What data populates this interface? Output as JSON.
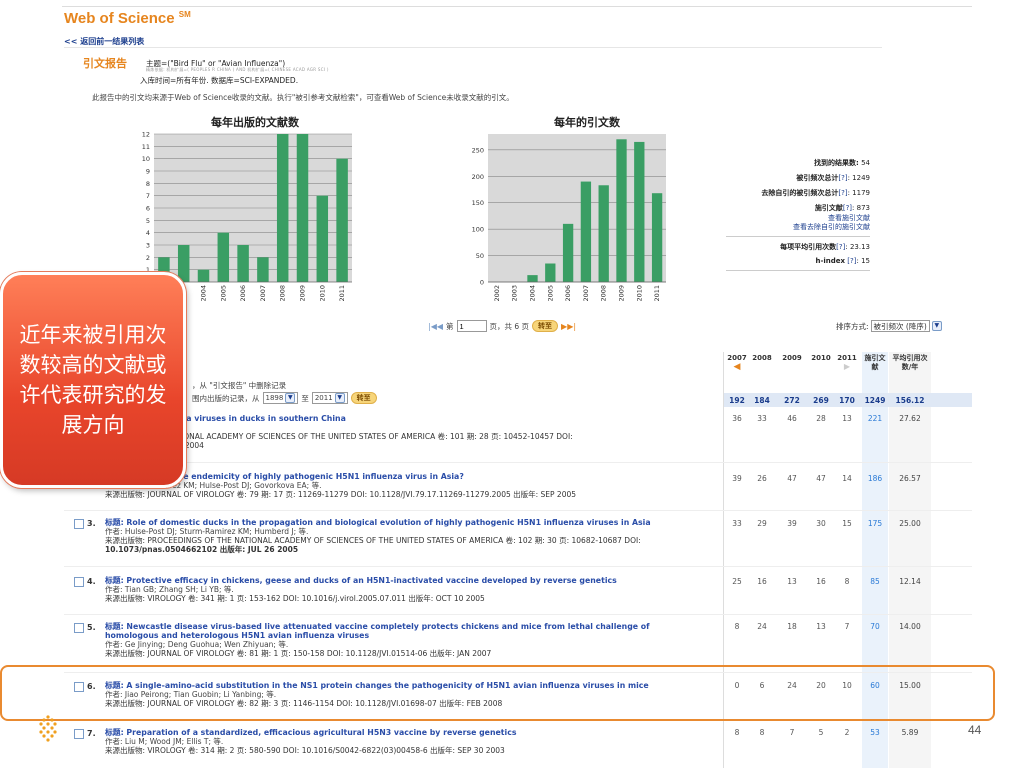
{
  "header": {
    "app_title": "Web of Science",
    "app_title_sup": "SM",
    "back_link": "<< 返回前一结果列表"
  },
  "report": {
    "label": "引文报告",
    "query": "主题=(\"Bird Flu\" or \"Avian Influenza\")",
    "query_refine": "精炼依据: 机构扩展=( PEOPLES R CHINA ) AND 机构扩展=( CHINESE ACAD AGR SCI )",
    "timespan": "入库时间=所有年份. 数据库=SCI-EXPANDED.",
    "notice": "此报告中的引文均来源于Web of Science收录的文献。执行\"被引参考文献检索\"，可查看Web of Science未收录文献的引文。"
  },
  "chart_data": [
    {
      "type": "bar",
      "title": "每年出版的文献数",
      "categories": [
        "2002",
        "2003",
        "2004",
        "2005",
        "2006",
        "2007",
        "2008",
        "2009",
        "2010",
        "2011"
      ],
      "values": [
        2,
        3,
        1,
        4,
        3,
        2,
        12,
        12,
        7,
        10
      ],
      "ylim": [
        0,
        12
      ],
      "yticks": [
        1,
        2,
        3,
        4,
        5,
        6,
        7,
        8,
        9,
        10,
        11,
        12
      ],
      "grid": true,
      "color": "#3a9e64"
    },
    {
      "type": "bar",
      "title": "每年的引文数",
      "categories": [
        "2002",
        "2003",
        "2004",
        "2005",
        "2006",
        "2007",
        "2008",
        "2009",
        "2010",
        "2011"
      ],
      "values": [
        0,
        0,
        13,
        35,
        110,
        190,
        183,
        270,
        265,
        168
      ],
      "ylim": [
        0,
        280
      ],
      "yticks": [
        0,
        50,
        100,
        150,
        200,
        250
      ],
      "grid": true,
      "color": "#3a9e64"
    }
  ],
  "stats": {
    "results_label": "找到的结果数:",
    "results_value": "54",
    "total_cites_label": "被引频次总计",
    "total_cites_value": "1249",
    "without_self_label": "去除自引的被引频次总计",
    "without_self_value": "1179",
    "citing_label": "施引文献",
    "citing_value": "873",
    "citing_link": "查看施引文献",
    "citing_noself_link": "查看去除自引的施引文献",
    "avg_label": "每项平均引用次数",
    "avg_value": "23.13",
    "hindex_label": "h-index",
    "hindex_value": "15",
    "help": "[?]"
  },
  "pager": {
    "page_prefix": "第",
    "page_value": "1",
    "page_suffix": "页，共 6 页",
    "go": "转至",
    "sort_label": "排序方式:",
    "sort_value": "被引频次 (降序)"
  },
  "remove": {
    "line1": "，从 \"引文报告\" 中删除记录",
    "line2_prefix": "围内出版的记录，从",
    "from_year": "1898",
    "to_label": "至",
    "to_year": "2011",
    "go": "转至"
  },
  "table": {
    "years": [
      "2007",
      "2008",
      "2009",
      "2010",
      "2011"
    ],
    "cited_header": "施引文献",
    "avg_header": "平均引用次数/年",
    "totals": [
      "192",
      "184",
      "272",
      "269",
      "170",
      "1249",
      "156.12"
    ]
  },
  "records": [
    {
      "num": "",
      "title": "n of H5N1 influenza viruses in ducks in southern China",
      "authors": "; Li Z; 等",
      "source": "EDINGS OF THE NATIONAL ACADEMY OF SCIENCES OF THE UNITED STATES OF AMERICA 卷: 101 期: 28 页: 10452-10457 DOI:",
      "extra": "12101 出版年: JUL 13 2004",
      "values": [
        "36",
        "33",
        "46",
        "28",
        "13",
        "221",
        "27.62"
      ]
    },
    {
      "num": "",
      "title": "contributing to the endemicity of highly pathogenic H5N1 influenza virus in Asia?",
      "authors": "作者: Sturm-Ramirez KM; Hulse-Post DJ; Govorkova EA; 等.",
      "source": "来源出版物: JOURNAL OF VIROLOGY 卷: 79 期: 17 页: 11269-11279 DOI: 10.1128/JVI.79.17.11269-11279.2005 出版年: SEP 2005",
      "extra": "",
      "values": [
        "39",
        "26",
        "47",
        "47",
        "14",
        "186",
        "26.57"
      ]
    },
    {
      "num": "3.",
      "title": "标题: Role of domestic ducks in the propagation and biological evolution of highly pathogenic H5N1 influenza viruses in Asia",
      "authors": "作者: Hulse-Post DJ; Sturm-Ramirez KM; Humberd J; 等.",
      "source": "来源出版物: PROCEEDINGS OF THE NATIONAL ACADEMY OF SCIENCES OF THE UNITED STATES OF AMERICA 卷: 102 期: 30 页: 10682-10687 DOI:",
      "extra": "10.1073/pnas.0504662102 出版年: JUL 26 2005",
      "values": [
        "33",
        "29",
        "39",
        "30",
        "15",
        "175",
        "25.00"
      ]
    },
    {
      "num": "4.",
      "title": "标题: Protective efficacy in chickens, geese and ducks of an H5N1-inactivated vaccine developed by reverse genetics",
      "authors": "作者: Tian GB; Zhang SH; Li YB; 等.",
      "source": "来源出版物: VIROLOGY 卷: 341 期: 1 页: 153-162 DOI: 10.1016/j.virol.2005.07.011 出版年: OCT 10 2005",
      "extra": "",
      "values": [
        "25",
        "16",
        "13",
        "16",
        "8",
        "85",
        "12.14"
      ]
    },
    {
      "num": "5.",
      "title": "标题: Newcastle disease virus-based live attenuated vaccine completely protects chickens and mice from lethal challenge of",
      "title2": "homologous and heterologous H5N1 avian influenza viruses",
      "authors": "作者: Ge Jinying; Deng Guohua; Wen Zhiyuan; 等.",
      "source": "来源出版物: JOURNAL OF VIROLOGY 卷: 81 期: 1 页: 150-158 DOI: 10.1128/JVI.01514-06 出版年: JAN 2007",
      "extra": "",
      "values": [
        "8",
        "24",
        "18",
        "13",
        "7",
        "70",
        "14.00"
      ]
    },
    {
      "num": "6.",
      "title": "标题: A single-amino-acid substitution in the NS1 protein changes the pathogenicity of H5N1 avian influenza viruses in mice",
      "authors": "作者: Jiao Peirong; Tian Guobin; Li Yanbing; 等.",
      "source": "来源出版物: JOURNAL OF VIROLOGY 卷: 82 期: 3 页: 1146-1154 DOI: 10.1128/JVI.01698-07 出版年: FEB 2008",
      "extra": "",
      "values": [
        "0",
        "6",
        "24",
        "20",
        "10",
        "60",
        "15.00"
      ]
    },
    {
      "num": "7.",
      "title": "标题: Preparation of a standardized, efficacious agricultural H5N3 vaccine by reverse genetics",
      "authors": "作者: Liu M; Wood JM; Ellis T; 等.",
      "source": "来源出版物: VIROLOGY 卷: 314 期: 2 页: 580-590 DOI: 10.1016/S0042-6822(03)00458-6 出版年: SEP 30 2003",
      "extra": "",
      "values": [
        "8",
        "8",
        "7",
        "5",
        "2",
        "53",
        "5.89"
      ]
    }
  ],
  "overlay": {
    "callout": "近年来被引用次数较高的文献或许代表研究的发展方向"
  },
  "slide": {
    "page_number": "44"
  }
}
